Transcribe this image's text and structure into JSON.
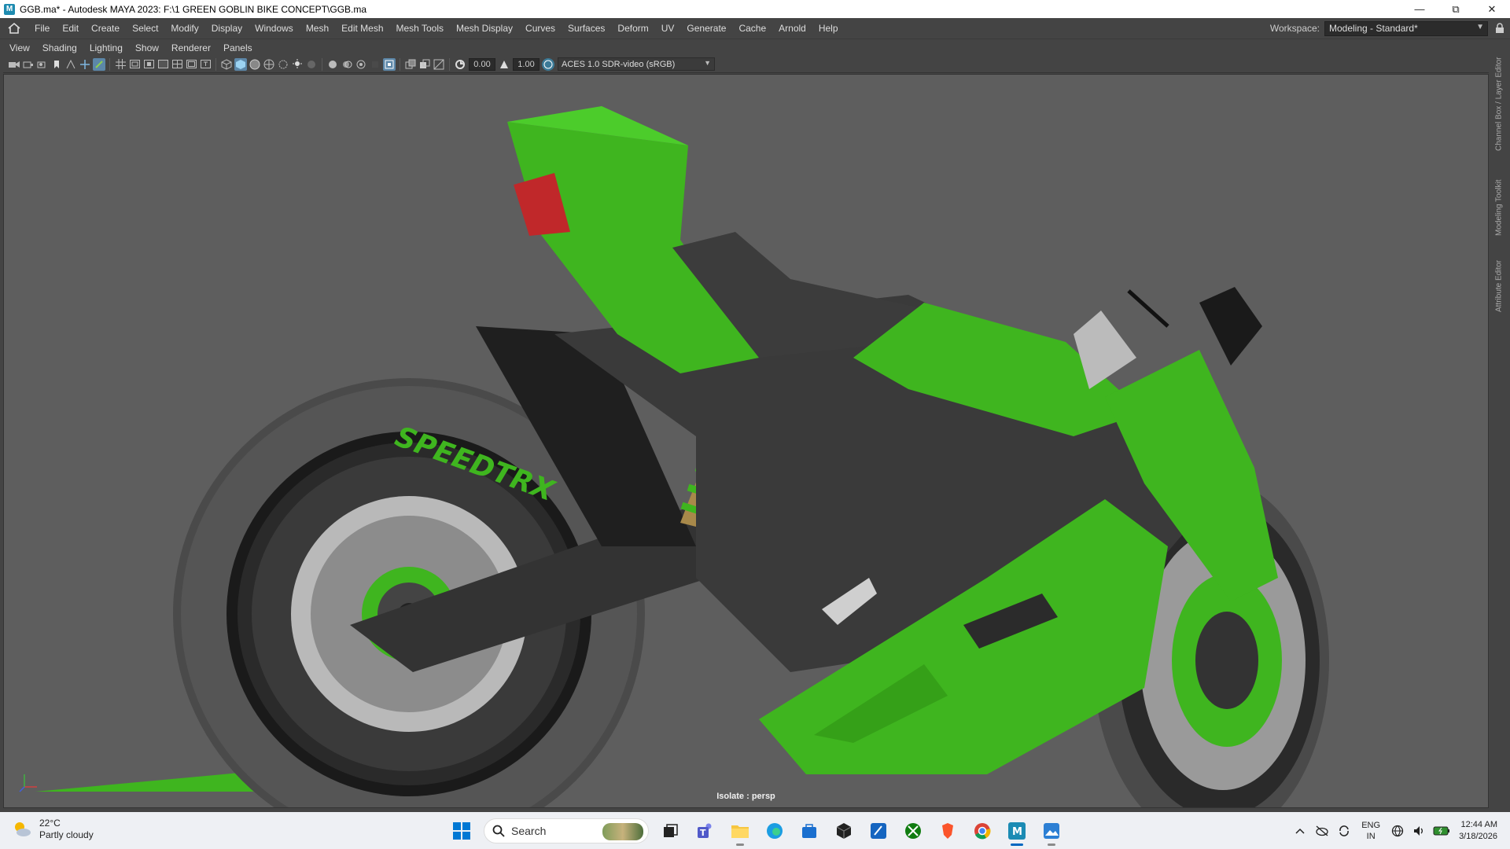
{
  "window": {
    "title": "GGB.ma* - Autodesk MAYA 2023: F:\\1 GREEN GOBLIN BIKE CONCEPT\\GGB.ma",
    "icon": "maya-icon"
  },
  "menubar": {
    "items": [
      "File",
      "Edit",
      "Create",
      "Select",
      "Modify",
      "Display",
      "Windows",
      "Mesh",
      "Edit Mesh",
      "Mesh Tools",
      "Mesh Display",
      "Curves",
      "Surfaces",
      "Deform",
      "UV",
      "Generate",
      "Cache",
      "Arnold",
      "Help"
    ],
    "workspace_label": "Workspace:",
    "workspace_value": "Modeling - Standard*"
  },
  "panel_menu": {
    "items": [
      "View",
      "Shading",
      "Lighting",
      "Show",
      "Renderer",
      "Panels"
    ]
  },
  "panel_toolbar": {
    "exposure": "0.00",
    "gamma": "1.00",
    "color_space": "ACES 1.0 SDR-video (sRGB)"
  },
  "viewport": {
    "label": "Isolate : persp",
    "background": "#5e5e5e",
    "accent_green": "#3fb51f",
    "rim_text": "SPEEDTRX"
  },
  "sidebar": {
    "tabs": [
      "Channel Box / Layer Editor",
      "Modeling Toolkit",
      "Attribute Editor"
    ]
  },
  "taskbar": {
    "weather_temp": "22°C",
    "weather_desc": "Partly cloudy",
    "search_label": "Search",
    "lang_top": "ENG",
    "lang_bottom": "IN",
    "time": "12:44 AM",
    "date": "3/18/2026"
  }
}
